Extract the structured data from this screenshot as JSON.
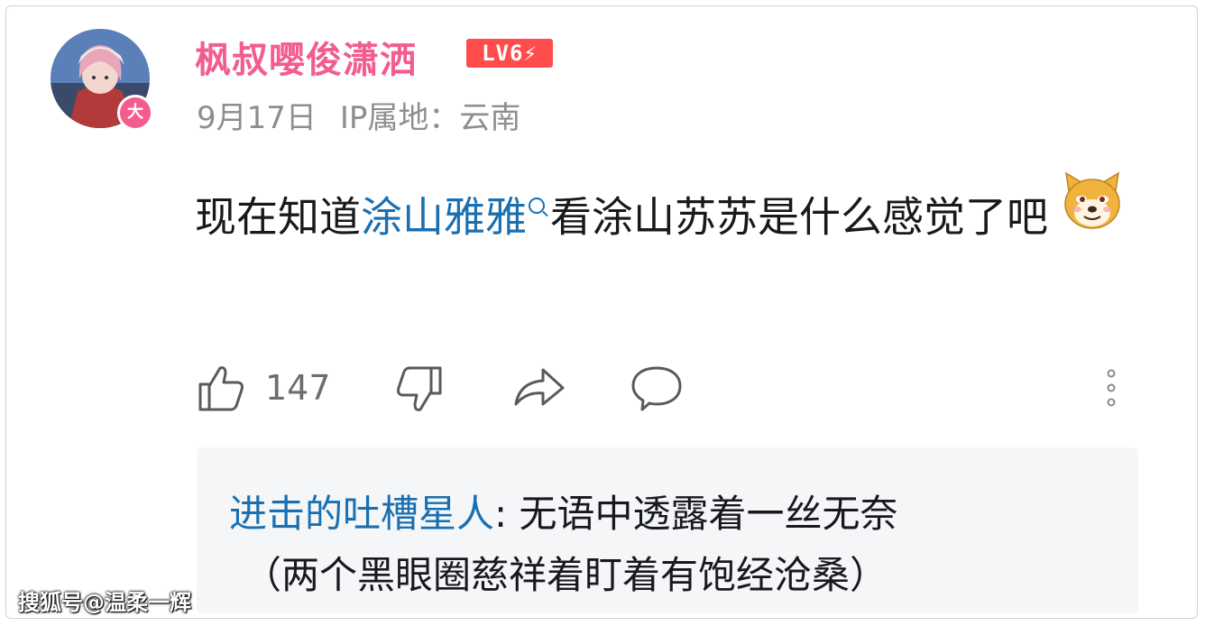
{
  "comment": {
    "username": "枫叔嘤俊潇洒",
    "level_badge": "LV6",
    "avatar_badge": "大",
    "date": "9月17日",
    "ip_location": "IP属地：云南",
    "content_before": "现在知道",
    "content_link": "涂山雅雅",
    "content_after": "看涂山苏苏是什么感觉了吧",
    "emoji_icon": "doge-emoji",
    "like_count": "147"
  },
  "reply": {
    "author": "进击的吐槽星人",
    "separator": ": ",
    "text_line1": "无语中透露着一丝无奈",
    "text_line2": "（两个黑眼圈慈祥着盯着有饱经沧桑）"
  },
  "watermark": "搜狐号@温柔一辉",
  "colors": {
    "username": "#f25d8e",
    "level_badge": "#ff4d4d",
    "link": "#1a6fb0",
    "meta": "#8e8e8e",
    "reply_bg": "#f4f6f8"
  }
}
